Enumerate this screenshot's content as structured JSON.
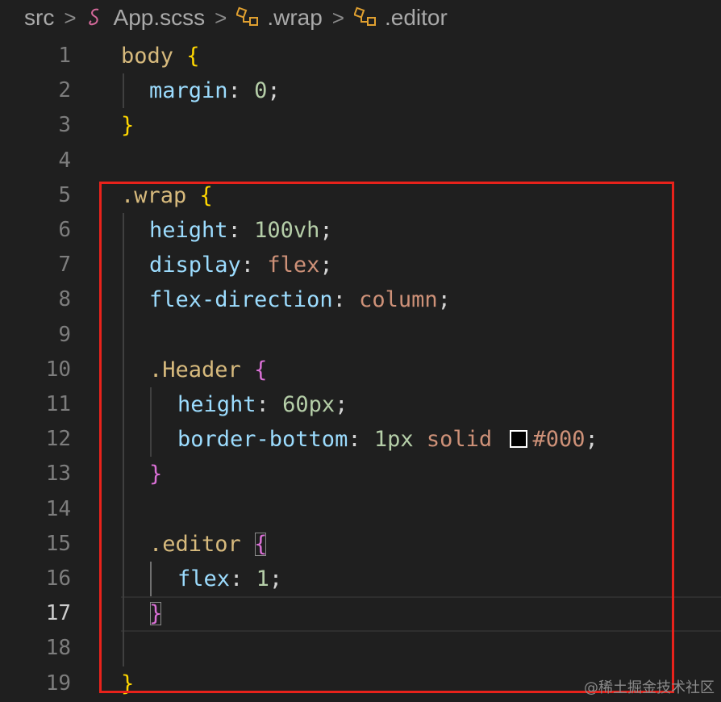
{
  "breadcrumb": {
    "folder": "src",
    "file": "App.scss",
    "symbol1": ".wrap",
    "symbol2": ".editor",
    "sep": ">"
  },
  "editor": {
    "active_line": "17",
    "line_numbers": [
      "1",
      "2",
      "3",
      "4",
      "5",
      "6",
      "7",
      "8",
      "9",
      "10",
      "11",
      "12",
      "13",
      "14",
      "15",
      "16",
      "17",
      "18",
      "19"
    ],
    "lines": {
      "l1": {
        "sel": "body",
        "brace": "{"
      },
      "l2": {
        "prop": "margin",
        "colon": ":",
        "val": "0",
        "semi": ";"
      },
      "l3": {
        "brace": "}"
      },
      "l5": {
        "sel": ".wrap",
        "brace": "{"
      },
      "l6": {
        "prop": "height",
        "colon": ":",
        "val": "100vh",
        "semi": ";"
      },
      "l7": {
        "prop": "display",
        "colon": ":",
        "val": "flex",
        "semi": ";"
      },
      "l8": {
        "prop": "flex-direction",
        "colon": ":",
        "val": "column",
        "semi": ";"
      },
      "l10": {
        "sel": ".Header",
        "brace": "{"
      },
      "l11": {
        "prop": "height",
        "colon": ":",
        "val": "60px",
        "semi": ";"
      },
      "l12": {
        "prop": "border-bottom",
        "colon": ":",
        "val1": "1px",
        "val2": "solid",
        "val3": "#000",
        "semi": ";"
      },
      "l13": {
        "brace": "}"
      },
      "l15": {
        "sel": ".editor",
        "brace": "{"
      },
      "l16": {
        "prop": "flex",
        "colon": ":",
        "val": "1",
        "semi": ";"
      },
      "l17": {
        "brace": "}"
      },
      "l19": {
        "brace": "}"
      }
    }
  },
  "watermark": "@稀土掘金技术社区",
  "colors": {
    "background": "#1f1f1f",
    "highlight_box": "#e8221b",
    "selector": "#d7ba7d",
    "property": "#9cdcfe",
    "number": "#b5cea8",
    "string": "#ce9178",
    "brace_level1": "#ffd700",
    "brace_level2": "#da70d6"
  }
}
